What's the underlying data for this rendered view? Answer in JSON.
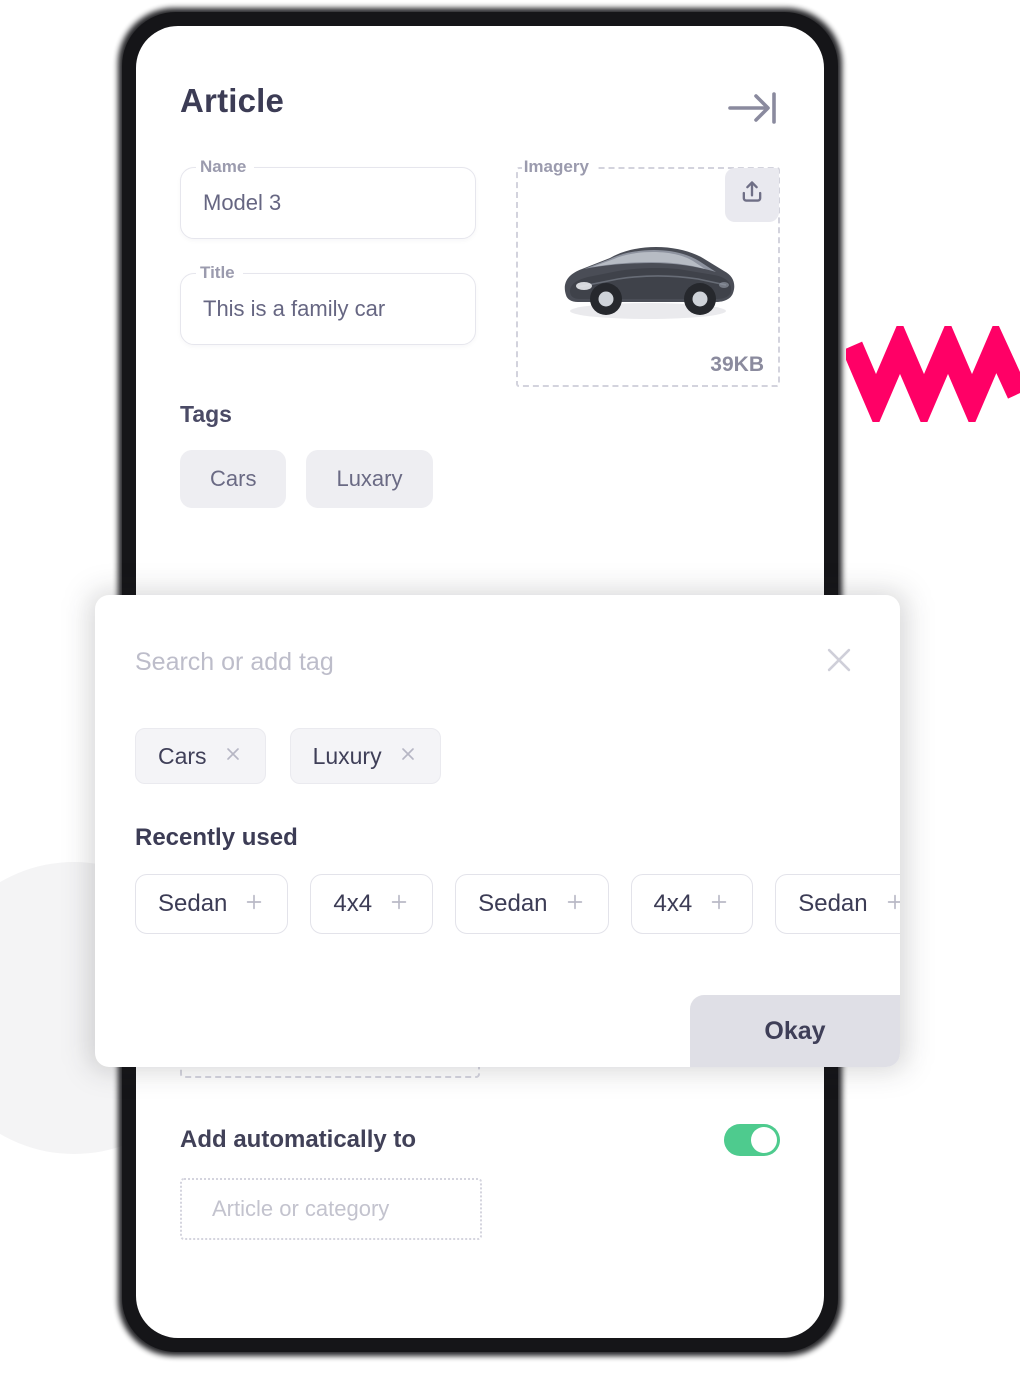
{
  "app": {
    "screen_title": "Article",
    "collapse_icon": "arrow-right-to-line-icon"
  },
  "form": {
    "name": {
      "label": "Name",
      "value": "Model 3"
    },
    "title": {
      "label": "Title",
      "value": "This is a family car"
    },
    "imagery": {
      "label": "Imagery",
      "file_size": "39KB",
      "upload_icon": "upload-icon",
      "preview_alt": "car-photo"
    }
  },
  "tags_section": {
    "heading": "Tags",
    "chips": [
      {
        "label": "Cars"
      },
      {
        "label": "Luxary"
      }
    ]
  },
  "auto_section": {
    "title": "Add automatically to",
    "toggle_on": true,
    "input_placeholder": "Article or category"
  },
  "modal": {
    "search_placeholder": "Search or add tag",
    "search_value": "",
    "close_icon": "close-icon",
    "selected_tags": [
      {
        "label": "Cars",
        "remove_icon": "close-icon"
      },
      {
        "label": "Luxury",
        "remove_icon": "close-icon"
      }
    ],
    "recent_heading": "Recently used",
    "recent_tags": [
      {
        "label": "Sedan",
        "add_icon": "plus-icon"
      },
      {
        "label": "4x4",
        "add_icon": "plus-icon"
      },
      {
        "label": "Sedan",
        "add_icon": "plus-icon"
      },
      {
        "label": "4x4",
        "add_icon": "plus-icon"
      },
      {
        "label": "Sedan",
        "add_icon": "plus-icon"
      }
    ],
    "confirm_label": "Okay"
  },
  "decoration": {
    "zigzag_color": "#FF0066",
    "circle_color": "#F4F4F5",
    "toggle_on_color": "#4ECB8E"
  }
}
